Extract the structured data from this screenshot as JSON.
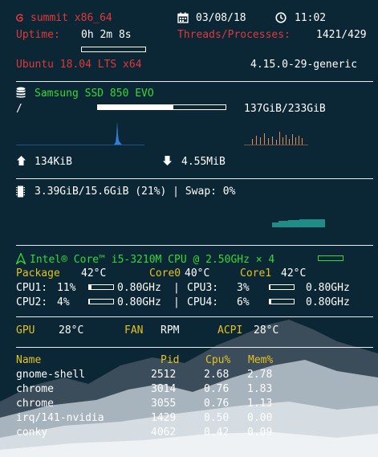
{
  "host": {
    "name": "summit x86_64",
    "date": "03/08/18",
    "time": "11:02",
    "uptime_label": "Uptime:",
    "uptime_value": "0h 2m 8s",
    "threads_label": "Threads/Processes:",
    "threads_value": "1421/429",
    "os": "Ubuntu 18.04 LTS x64",
    "kernel": "4.15.0-29-generic"
  },
  "disk": {
    "name": "Samsung SSD 850 EVO",
    "mount": "/",
    "usage": "137GiB/233GiB",
    "used_fraction": 0.59,
    "upload": "134KiB",
    "download": "4.55MiB"
  },
  "memory": {
    "usage": "3.39GiB/15.6GiB (21%) | Swap: 0%"
  },
  "cpu": {
    "model": "Intel® Core™ i5-3210M CPU @ 2.50GHz × 4",
    "package_label": "Package",
    "package_temp": "42°C",
    "core0_label": "Core0",
    "core0_temp": "40°C",
    "core1_label": "Core1",
    "core1_temp": "42°C",
    "cores": [
      {
        "label": "CPU1:",
        "pct": "11%",
        "frac": 0.11,
        "freq": "0.80GHz"
      },
      {
        "label": "CPU2:",
        "pct": "4%",
        "frac": 0.04,
        "freq": "0.80GHz"
      },
      {
        "label": "CPU3:",
        "pct": "3%",
        "frac": 0.03,
        "freq": "0.80GHz"
      },
      {
        "label": "CPU4:",
        "pct": "6%",
        "frac": 0.06,
        "freq": "0.80GHz"
      }
    ]
  },
  "sensors": {
    "gpu_label": "GPU",
    "gpu_temp": "28°C",
    "fan_label": "FAN",
    "fan_value": "RPM",
    "acpi_label": "ACPI",
    "acpi_temp": "28°C"
  },
  "processes": {
    "headers": [
      "Name",
      "Pid",
      "Cpu%",
      "Mem%"
    ],
    "rows": [
      [
        "gnome-shell",
        "2512",
        "2.68",
        "2.78"
      ],
      [
        "chrome",
        "3014",
        "0.76",
        "1.83"
      ],
      [
        "chrome",
        "3055",
        "0.76",
        "1.13"
      ],
      [
        "irq/141-nvidia",
        "1429",
        "0.50",
        "0.00"
      ],
      [
        "conky",
        "4062",
        "0.42",
        "0.09"
      ]
    ]
  },
  "colors": {
    "background": "#0b2634",
    "red": "#e0393a",
    "green": "#33d93a",
    "yellow": "#e6c21d",
    "disk_read_graph": "#2f7fd8",
    "disk_write_graph": "#e58a55",
    "memory_graph": "#1f8d86"
  },
  "icons": {
    "os": "debian-swirl-icon",
    "date": "calendar-icon",
    "time": "clock-icon",
    "disk": "database-icon",
    "upload": "arrow-up-icon",
    "download": "arrow-down-icon",
    "memory": "memory-chip-icon",
    "cpu": "arch-logo-icon"
  }
}
